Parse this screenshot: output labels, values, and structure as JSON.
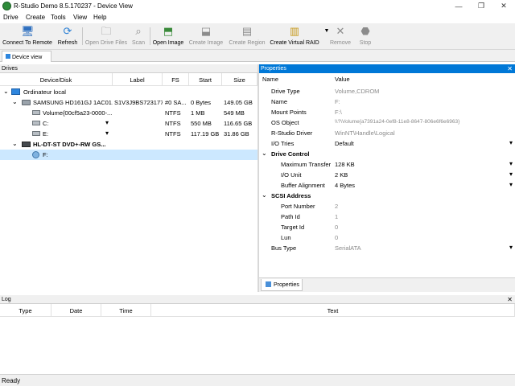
{
  "window": {
    "title": "R-Studio Demo 8.5.170237 - Device View",
    "minimize": "—",
    "maximize": "❐",
    "close": "✕"
  },
  "menu": [
    "Drive",
    "Create",
    "Tools",
    "View",
    "Help"
  ],
  "toolbar": {
    "connect": "Connect To Remote",
    "refresh": "Refresh",
    "open_drive_files": "Open Drive Files",
    "scan": "Scan",
    "open_image": "Open Image",
    "create_image": "Create Image",
    "create_region": "Create Region",
    "create_virtual_raid": "Create Virtual RAID",
    "remove": "Remove",
    "stop": "Stop"
  },
  "tabs": {
    "device_view": "Device view"
  },
  "drives_panel": {
    "title": "Drives",
    "columns": [
      "Device/Disk",
      "Label",
      "FS",
      "Start",
      "Size"
    ],
    "rows": [
      {
        "device": "Ordinateur local",
        "label": "",
        "fs": "",
        "start": "",
        "size": ""
      },
      {
        "device": "SAMSUNG HD161GJ 1AC01...",
        "label": "S1V3J9BS723177",
        "fs": "#0 SA...",
        "start": "0 Bytes",
        "size": "149.05 GB"
      },
      {
        "device": "Volume{00cf5a23-0000-...",
        "label": "",
        "fs": "NTFS",
        "start": "1 MB",
        "size": "549 MB"
      },
      {
        "device": "C:",
        "label": "",
        "fs": "NTFS",
        "start": "550 MB",
        "size": "116.65 GB"
      },
      {
        "device": "E:",
        "label": "",
        "fs": "NTFS",
        "start": "117.19 GB",
        "size": "31.86 GB"
      },
      {
        "device": "HL-DT-ST DVD+-RW GS...",
        "label": "",
        "fs": "",
        "start": "",
        "size": ""
      },
      {
        "device": "F:",
        "label": "",
        "fs": "",
        "start": "",
        "size": ""
      }
    ]
  },
  "properties_panel": {
    "title": "Properties",
    "col_name": "Name",
    "col_value": "Value",
    "rows": [
      {
        "name": "Drive Type",
        "value": "Volume,CDROM"
      },
      {
        "name": "Name",
        "value": "F:"
      },
      {
        "name": "Mount Points",
        "value": "F:\\"
      },
      {
        "name": "OS Object",
        "value": "\\\\?\\Volume{a7391a24-0ef8-11e8-8647-806e6f6e6963}"
      },
      {
        "name": "R-Studio Driver",
        "value": "WinNT\\Handle\\Logical"
      },
      {
        "name": "I/O Tries",
        "value": "Default"
      },
      {
        "name": "Drive Control",
        "value": ""
      },
      {
        "name": "Maximum Transfer",
        "value": "128 KB"
      },
      {
        "name": "I/O Unit",
        "value": "2 KB"
      },
      {
        "name": "Buffer Alignment",
        "value": "4 Bytes"
      },
      {
        "name": "SCSI Address",
        "value": ""
      },
      {
        "name": "Port Number",
        "value": "2"
      },
      {
        "name": "Path Id",
        "value": "1"
      },
      {
        "name": "Target Id",
        "value": "0"
      },
      {
        "name": "Lun",
        "value": "0"
      },
      {
        "name": "Bus Type",
        "value": "SerialATA"
      }
    ],
    "tab_label": "Properties"
  },
  "log_panel": {
    "title": "Log",
    "columns": [
      "Type",
      "Date",
      "Time",
      "Text"
    ]
  },
  "status": "Ready",
  "colors": {
    "accent": "#0078d7",
    "selection": "#cce8ff"
  }
}
